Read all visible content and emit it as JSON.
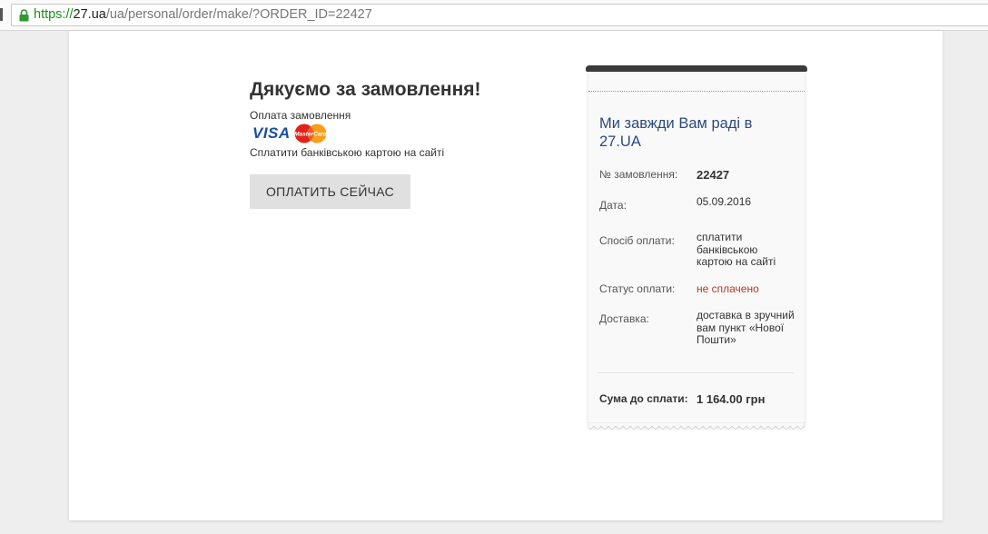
{
  "browser": {
    "url_scheme": "https://",
    "url_host": "27.ua",
    "url_path": "/ua/personal/order/make/?ORDER_ID=22427"
  },
  "order": {
    "title": "Дякуємо за замовлення!",
    "payment_label": "Оплата замовлення",
    "visa_text": "VISA",
    "mastercard_text": "MasterCard",
    "payment_desc": "Сплатити банківською картою на сайті",
    "pay_button": "ОПЛАТИТЬ СЕЙЧАС"
  },
  "receipt": {
    "heading": "Ми завжди Вам раді в 27.UA",
    "rows": [
      {
        "label": "№ замовлення:",
        "value": "22427"
      },
      {
        "label": "Дата:",
        "value": "05.09.2016"
      },
      {
        "label": "Спосіб оплати:",
        "value": "сплатити банківською картою на сайті"
      },
      {
        "label": "Статус оплати:",
        "value": "не сплачено"
      },
      {
        "label": "Доставка:",
        "value": "доставка в зручний вам пункт «Нової Пошти»"
      }
    ],
    "total_label": "Сума до сплати:",
    "total_value": "1 164.00 грн"
  },
  "colors": {
    "url_scheme": "#1b8f1b",
    "receipt_heading": "#2e4a7a",
    "status_unpaid": "#b23a1e",
    "visa_blue": "#1a4ea0"
  }
}
